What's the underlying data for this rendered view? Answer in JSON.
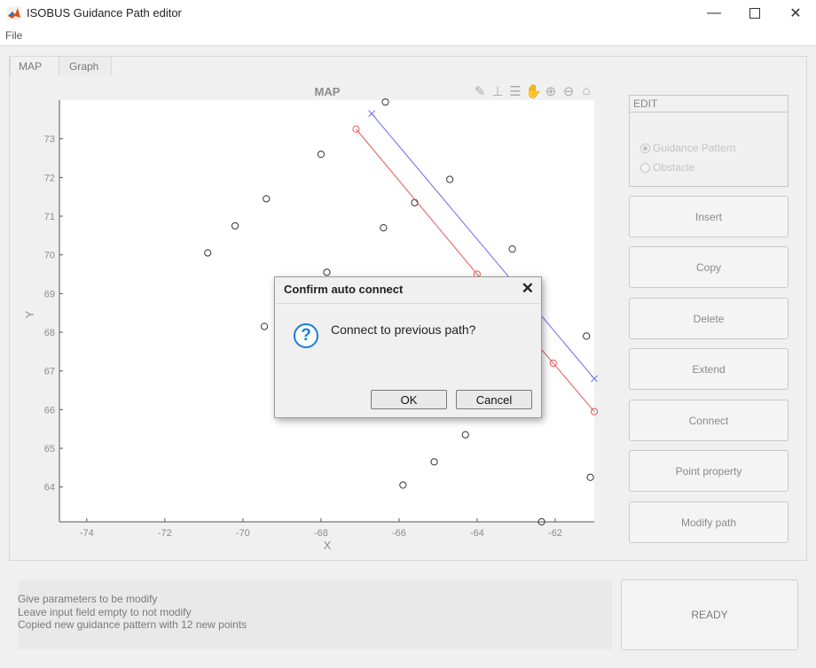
{
  "window": {
    "title": "ISOBUS Guidance Path editor",
    "minimize_icon": "minimize-icon",
    "maximize_icon": "maximize-icon",
    "close_icon": "close-icon"
  },
  "menu": {
    "file": "File"
  },
  "tabs": [
    {
      "label": "MAP"
    },
    {
      "label": "Graph"
    }
  ],
  "toolbar": {
    "icons": [
      "brush-icon",
      "datatip-icon",
      "legend-icon",
      "pan-icon",
      "zoom-in-icon",
      "zoom-out-icon",
      "home-icon"
    ]
  },
  "chart_data": {
    "type": "scatter",
    "title": "MAP",
    "xlabel": "X",
    "ylabel": "Y",
    "xlim": [
      -74.7,
      -61.0
    ],
    "ylim": [
      63.1,
      74.0
    ],
    "xticks": [
      -74,
      -72,
      -70,
      -68,
      -66,
      -64,
      -62
    ],
    "yticks": [
      64,
      65,
      66,
      67,
      68,
      69,
      70,
      71,
      72,
      73
    ],
    "grid": false,
    "series": [
      {
        "color": "#333333",
        "marker": "circle",
        "points": [
          [
            -70.9,
            70.05
          ],
          [
            -70.2,
            70.75
          ],
          [
            -69.4,
            71.45
          ],
          [
            -68.0,
            72.6
          ],
          [
            -66.35,
            73.95
          ],
          [
            -66.4,
            70.7
          ],
          [
            -65.6,
            71.35
          ],
          [
            -64.7,
            71.95
          ],
          [
            -67.85,
            69.55
          ],
          [
            -69.45,
            68.15
          ],
          [
            -63.1,
            70.15
          ],
          [
            -61.2,
            67.9
          ],
          [
            -64.3,
            65.35
          ],
          [
            -65.1,
            64.65
          ],
          [
            -65.9,
            64.05
          ],
          [
            -62.35,
            63.1
          ],
          [
            -61.1,
            64.25
          ]
        ]
      },
      {
        "color": "#e35a5a",
        "marker": "circle",
        "line": true,
        "points": [
          [
            -67.1,
            73.25
          ],
          [
            -64.0,
            69.5
          ],
          [
            -62.05,
            67.2
          ],
          [
            -61.0,
            65.95
          ]
        ]
      },
      {
        "color": "#6a6aee",
        "marker": "x",
        "line": true,
        "points": [
          [
            -66.7,
            73.65
          ],
          [
            -61.0,
            66.8
          ]
        ]
      }
    ]
  },
  "edit": {
    "title": "EDIT",
    "options": [
      {
        "label": "Guidance Pattern",
        "selected": true
      },
      {
        "label": "Obstacle",
        "selected": false
      }
    ]
  },
  "buttons": [
    "Insert",
    "Copy",
    "Delete",
    "Extend",
    "Connect",
    "Point property",
    "Modify path"
  ],
  "status": {
    "lines": [
      "Give parameters to be modify",
      "Leave input field empty to not modify",
      "Copied new guidance pattern with 12 new points"
    ],
    "ready": "READY"
  },
  "dialog": {
    "title": "Confirm auto connect",
    "message": "Connect to previous path?",
    "icon": "question-icon",
    "ok": "OK",
    "cancel": "Cancel"
  }
}
